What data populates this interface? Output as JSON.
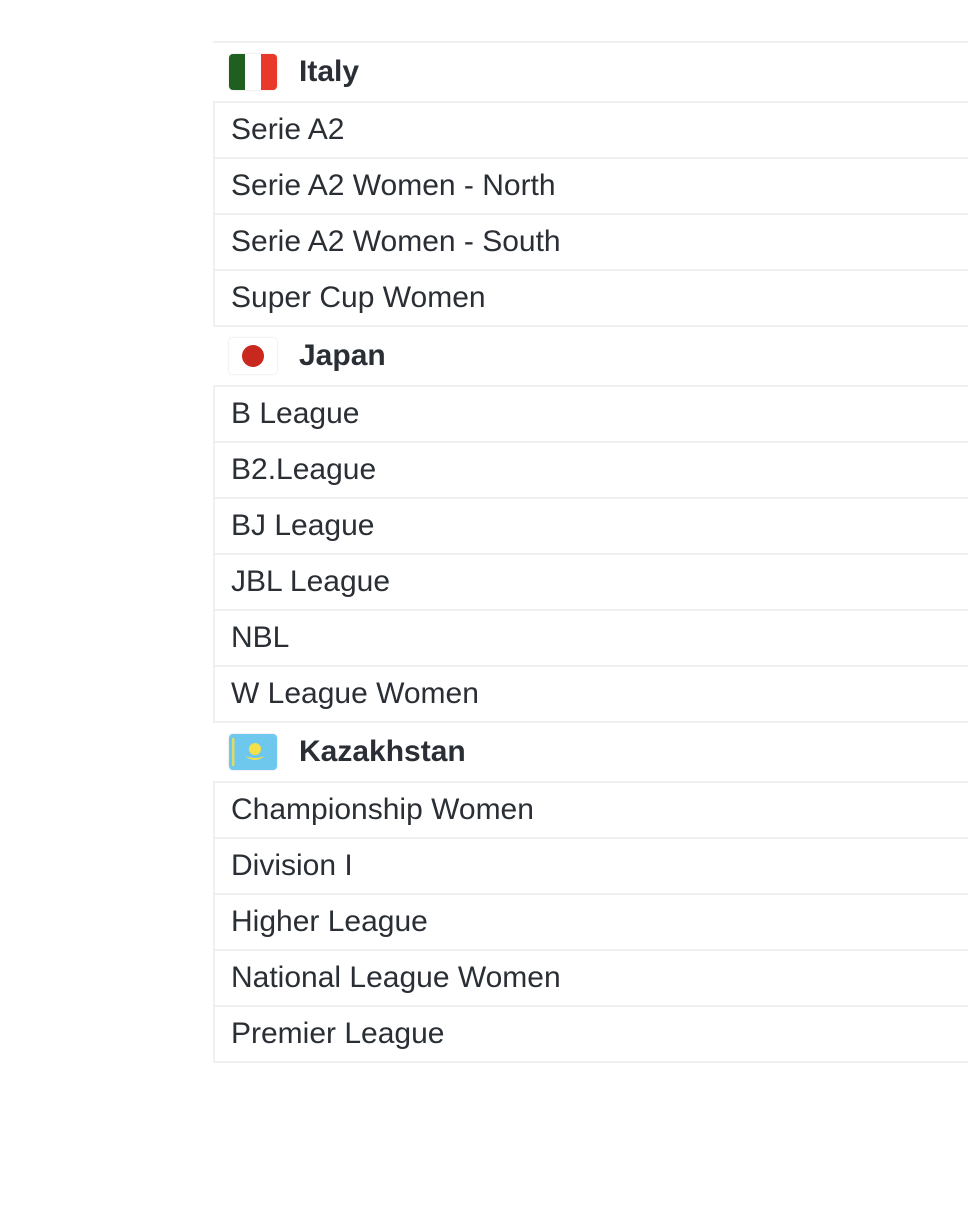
{
  "groups": [
    {
      "country": "Italy",
      "flag_icon": "italy-flag-icon",
      "leagues": [
        "Serie A2",
        "Serie A2 Women - North",
        "Serie A2 Women - South",
        "Super Cup Women"
      ]
    },
    {
      "country": "Japan",
      "flag_icon": "japan-flag-icon",
      "leagues": [
        "B League",
        "B2.League",
        "BJ League",
        "JBL League",
        "NBL",
        "W League Women"
      ]
    },
    {
      "country": "Kazakhstan",
      "flag_icon": "kazakhstan-flag-icon",
      "leagues": [
        "Championship Women",
        "Division I",
        "Higher League",
        "National League Women",
        "Premier League"
      ]
    }
  ],
  "colors": {
    "divider": "#eef0f2",
    "text": "#2a2e35",
    "italy_green": "#1f5f1f",
    "italy_red": "#e8392b",
    "japan_red": "#c8281e",
    "kazakhstan_blue": "#6ec8ee",
    "kazakhstan_gold": "#f5e04a"
  }
}
